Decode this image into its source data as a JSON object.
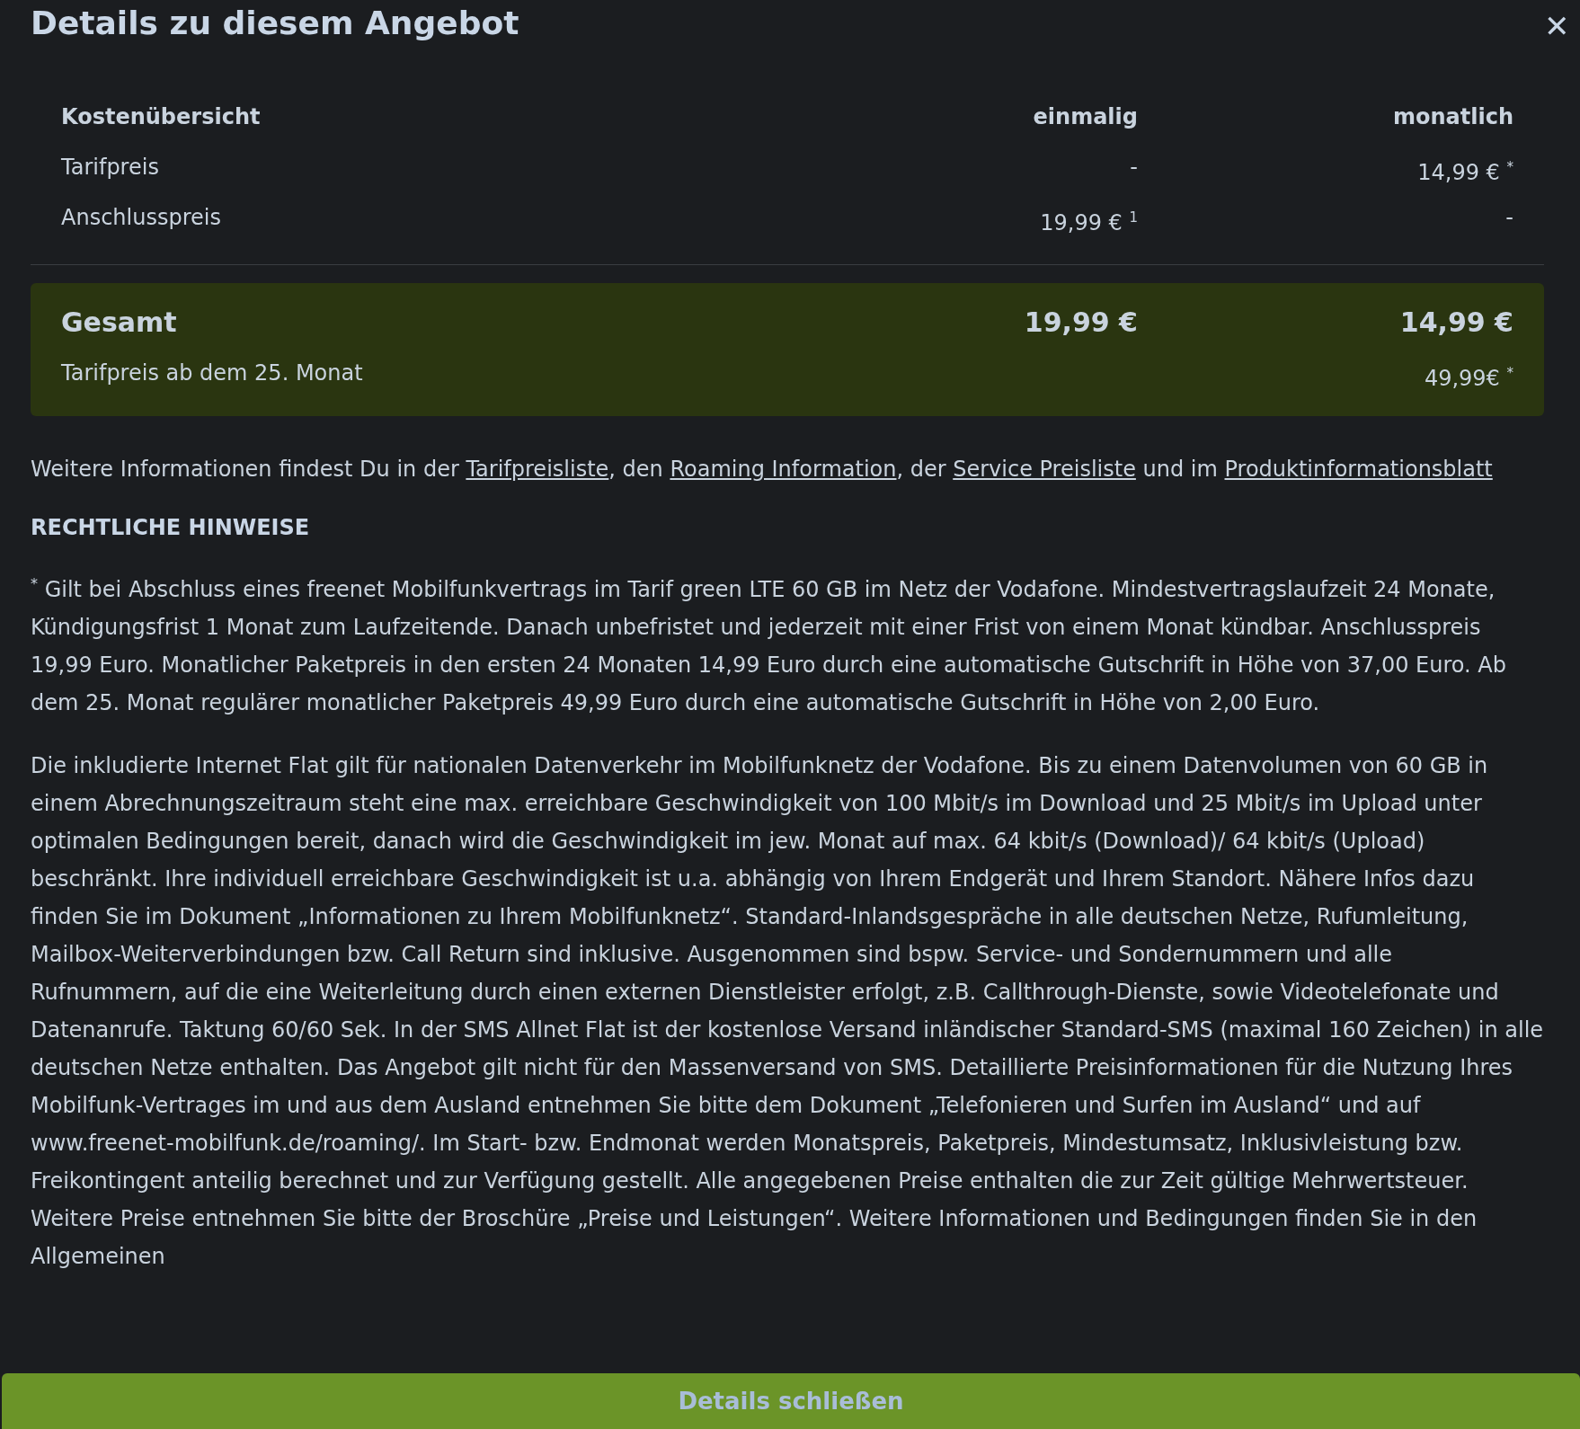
{
  "dialog": {
    "title": "Details zu diesem Angebot",
    "close_icon": "✕"
  },
  "cost_table": {
    "columns": [
      "Kostenübersicht",
      "einmalig",
      "monatlich"
    ],
    "rows": [
      {
        "label": "Tarifpreis",
        "once": "-",
        "monthly": "14,99 € $^{*}$"
      },
      {
        "label": "Anschlusspreis",
        "once": "19,99 € $^{1}$",
        "monthly": "-"
      }
    ],
    "total": {
      "label": "Gesamt",
      "once": "19,99 €",
      "monthly": "14,99 €"
    },
    "later": {
      "label": "Tarifpreis ab dem 25. Monat",
      "monthly": "49,99€ $^{*}$"
    }
  },
  "info": [
    {
      "kind": "text",
      "text": "Weitere Informationen findest Du in der "
    },
    {
      "kind": "link",
      "text": "Tarifpreisliste"
    },
    {
      "kind": "text",
      "text": ", den "
    },
    {
      "kind": "link",
      "text": "Roaming Information"
    },
    {
      "kind": "text",
      "text": ", der "
    },
    {
      "kind": "link",
      "text": "Service Preisliste"
    },
    {
      "kind": "text",
      "text": " und im "
    },
    {
      "kind": "link",
      "text": "Produktinformationsblatt"
    }
  ],
  "legal": {
    "heading": "RECHTLICHE HINWEISE",
    "paragraphs": [
      "$^{*}$ Gilt bei Abschluss eines freenet Mobilfunkvertrags im Tarif green LTE 60 GB im Netz der Vodafone. Mindestvertragslaufzeit 24 Monate, Kündigungsfrist 1 Monat zum Laufzeitende. Danach unbefristet und jederzeit mit einer Frist von einem Monat kündbar. Anschlusspreis 19,99 Euro. Monatlicher Paketpreis in den ersten 24 Monaten 14,99 Euro durch eine automatische Gutschrift in Höhe von 37,00 Euro. Ab dem 25. Monat regulärer monatlicher Paketpreis 49,99 Euro durch eine automatische Gutschrift in Höhe von 2,00 Euro.",
      "Die inkludierte Internet Flat gilt für nationalen Datenverkehr im Mobilfunknetz der Vodafone. Bis zu einem Datenvolumen von 60 GB in einem Abrechnungszeitraum steht eine max. erreichbare Geschwindigkeit von 100 Mbit/s im Download und 25 Mbit/s im Upload unter optimalen Bedingungen bereit, danach wird die Geschwindigkeit im jew. Monat auf max. 64 kbit/s (Download)/ 64 kbit/s (Upload) beschränkt. Ihre individuell erreichbare Geschwindigkeit ist u.a. abhängig von Ihrem Endgerät und Ihrem Standort. Nähere Infos dazu finden Sie im Dokument „Informationen zu Ihrem Mobilfunknetz“. Standard-Inlandsgespräche in alle deutschen Netze, Rufumleitung, Mailbox-Weiterverbindungen bzw. Call Return sind inklusive. Ausgenommen sind bspw. Service- und Sondernummern und alle Rufnummern, auf die eine Weiterleitung durch einen externen Dienstleister erfolgt, z.B. Callthrough-Dienste, sowie Videotelefonate und Datenanrufe. Taktung 60/60 Sek. In der SMS Allnet Flat ist der kostenlose Versand inländischer Standard-SMS (maximal 160 Zeichen) in alle deutschen Netze enthalten. Das Angebot gilt nicht für den Massenversand von SMS. Detaillierte Preisinformationen für die Nutzung Ihres Mobilfunk-Vertrages im und aus dem Ausland entnehmen Sie bitte dem Dokument „Telefonieren und Surfen im Ausland“ und auf www.freenet-mobilfunk.de/roaming/. Im Start- bzw. Endmonat werden Monatspreis, Paketpreis, Mindestumsatz, Inklusivleistung bzw. Freikontingent anteilig berechnet und zur Verfügung gestellt. Alle angegebenen Preise enthalten die zur Zeit gültige Mehrwertsteuer. Weitere Preise entnehmen Sie bitte der Broschüre „Preise und Leistungen“. Weitere Informationen und Bedingungen finden Sie in den Allgemeinen"
    ]
  },
  "footer_button": "Details schließen"
}
